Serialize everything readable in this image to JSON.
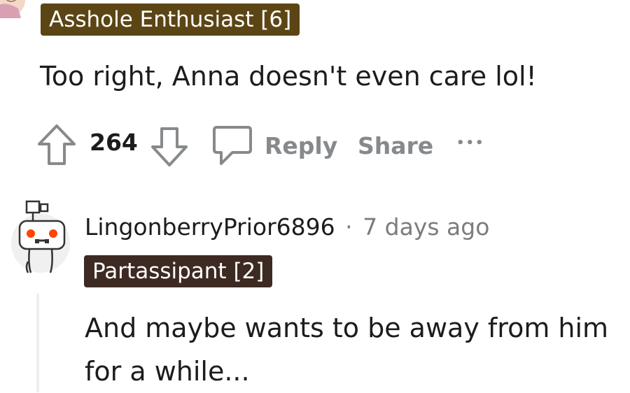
{
  "comment1": {
    "flair": "Asshole Enthusiast [6]",
    "flair_color": "#5c4515",
    "text": "Too right, Anna doesn't even care lol!",
    "actions": {
      "upvote_count": "264",
      "reply_label": "Reply",
      "share_label": "Share",
      "more_label": "•••"
    }
  },
  "comment2": {
    "username": "LingonberryPrior6896",
    "separator": "·",
    "timestamp": "7 days ago",
    "flair": "Partassipant [2]",
    "flair_color": "#3d2a22",
    "text": "And maybe wants to be away from him for a while..."
  },
  "colors": {
    "action_gray": "#878a8c",
    "meta_gray": "#7c7c7c",
    "thread_line": "#edeff1",
    "text": "#1c1c1c"
  },
  "icons": [
    "avatar",
    "upvote-arrow-icon",
    "downvote-arrow-icon",
    "comment-bubble-icon",
    "more-options-icon",
    "snoo-avatar"
  ]
}
